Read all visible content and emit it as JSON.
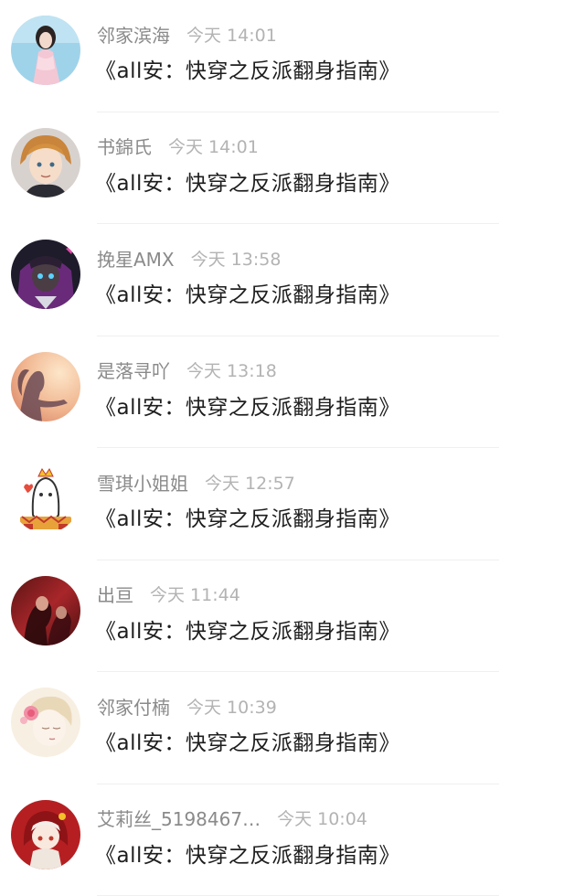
{
  "messages": [
    {
      "name": "邻家滨海",
      "time": "今天 14:01",
      "text": "《all安：快穿之反派翻身指南》",
      "avatar_icon": "girl-pink-dress-avatar"
    },
    {
      "name": "书錦氏",
      "time": "今天 14:01",
      "text": "《all安：快穿之反派翻身指南》",
      "avatar_icon": "anime-boy-avatar"
    },
    {
      "name": "挽星AMX",
      "time": "今天 13:58",
      "text": "《all安：快穿之反派翻身指南》",
      "avatar_icon": "anime-character-dark-avatar"
    },
    {
      "name": "是落寻吖",
      "time": "今天 13:18",
      "text": "《all安：快穿之反派翻身指南》",
      "avatar_icon": "silhouette-sunset-avatar"
    },
    {
      "name": "雪琪小姐姐",
      "time": "今天 12:57",
      "text": "《all安：快穿之反派翻身指南》",
      "avatar_icon": "cartoon-ghost-crown-avatar"
    },
    {
      "name": "出亘",
      "time": "今天 11:44",
      "text": "《all安：快穿之反派翻身指南》",
      "avatar_icon": "red-figures-avatar"
    },
    {
      "name": "邻家付楠",
      "time": "今天 10:39",
      "text": "《all安：快穿之反派翻身指南》",
      "avatar_icon": "sketch-girl-flower-avatar"
    },
    {
      "name": "艾莉丝_5198467…",
      "time": "今天 10:04",
      "text": "《all安：快穿之反派翻身指南》",
      "avatar_icon": "chibi-red-hood-avatar"
    }
  ]
}
